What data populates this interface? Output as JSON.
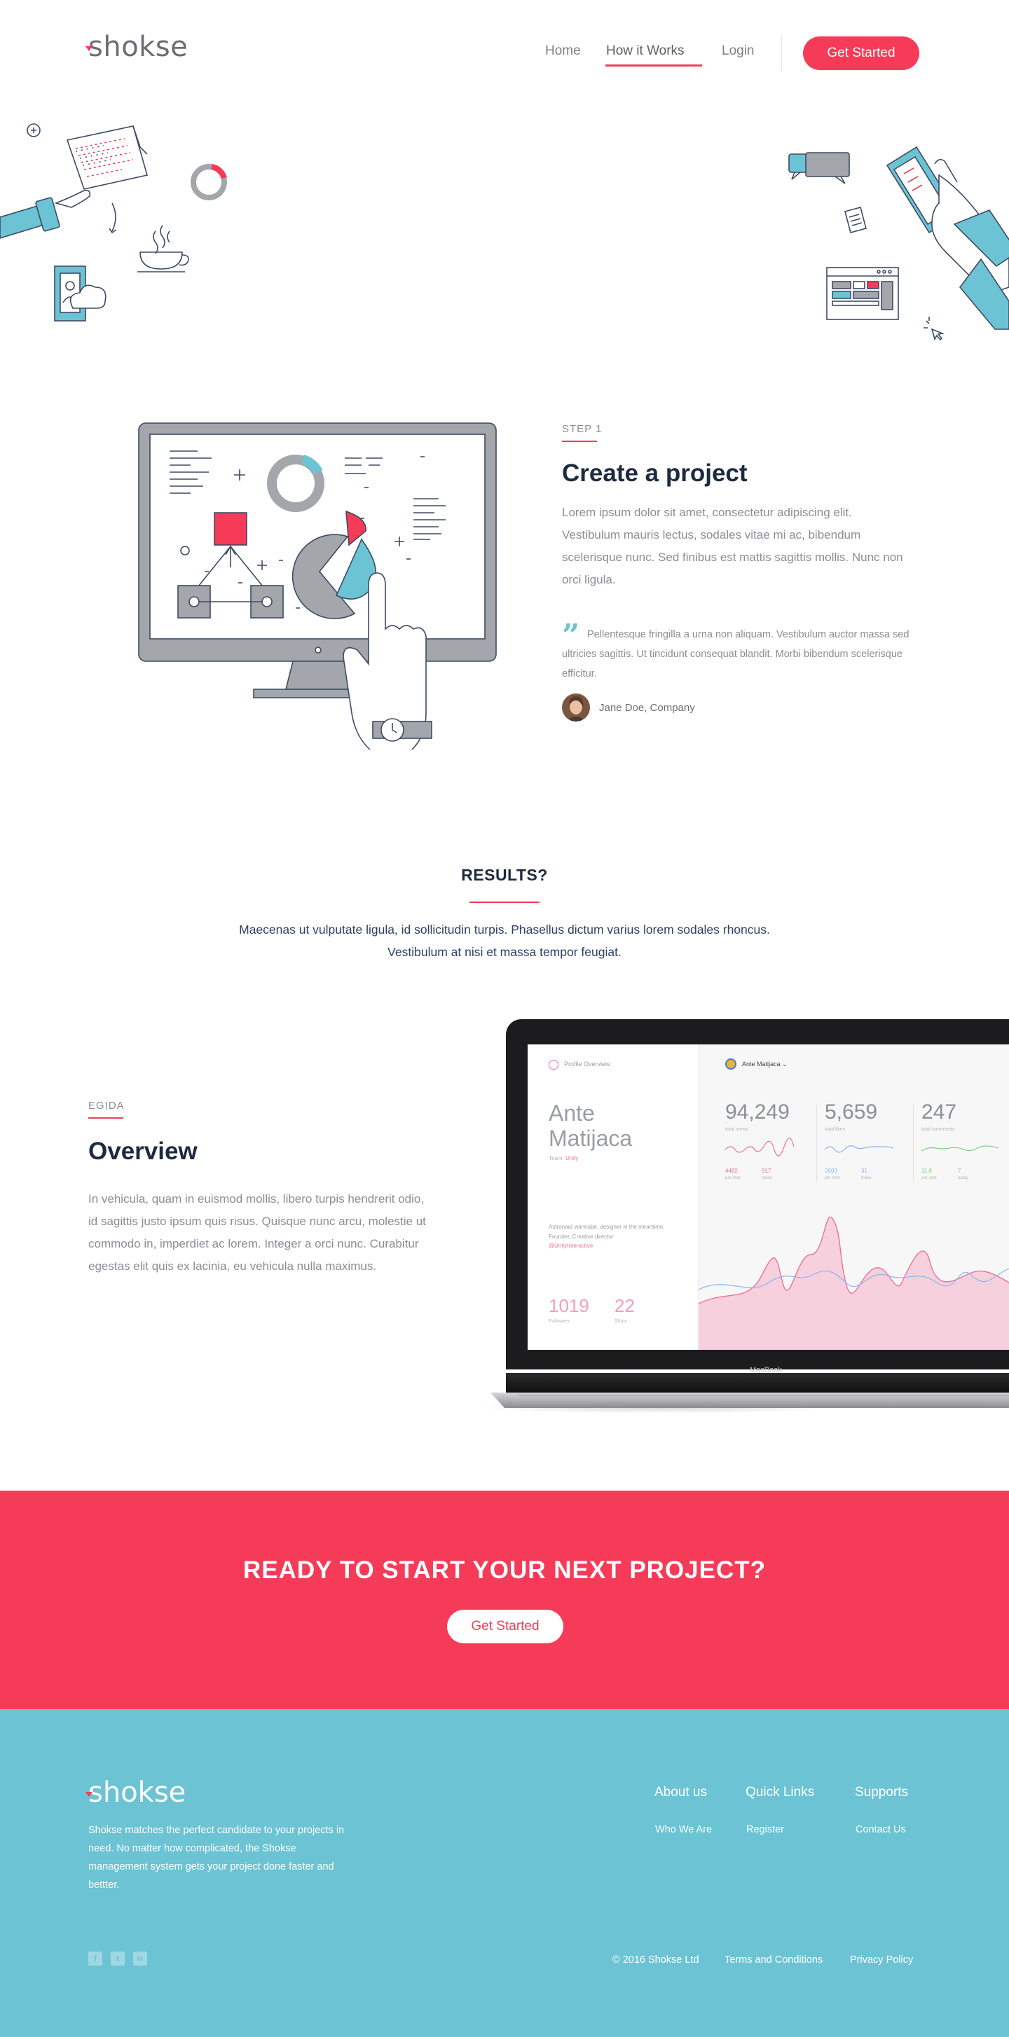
{
  "brand": {
    "name": "shokse",
    "accent": "#f53b57",
    "teal": "#6cc3d4",
    "dark": "#1d2a3f"
  },
  "nav": {
    "items": [
      {
        "label": "Home",
        "active": false
      },
      {
        "label": "How it Works",
        "active": true
      },
      {
        "label": "Login",
        "active": false
      }
    ],
    "cta": "Get Started"
  },
  "step": {
    "label": "STEP 1",
    "title": "Create a project",
    "body": "Lorem ipsum dolor sit amet, consectetur adipiscing elit. Vestibulum mauris lectus, sodales vitae mi ac, bibendum scelerisque nunc. Sed finibus est mattis sagittis mollis. Nunc non orci ligula.",
    "quote": "Pellentesque fringilla a urna non aliquam. Vestibulum auctor massa sed ultricies sagittis.  Ut tincidunt consequat blandit. Morbi bibendum scelerisque efficitur.",
    "author": "Jane Doe, Company"
  },
  "results": {
    "title": "RESULTS?",
    "body": "Maecenas ut vulputate ligula, id sollicitudin turpis. Phasellus dictum varius lorem sodales rhoncus. Vestibulum at nisi et massa tempor feugiat."
  },
  "overview": {
    "label": "EGIDA",
    "title": "Overview",
    "body": "In vehicula, quam in euismod mollis, libero turpis hendrerit odio, id sagittis justo ipsum quis risus. Quisque nunc arcu, molestie ut commodo in, imperdiet ac lorem. Integer a orci nunc. Curabitur egestas elit quis ex lacinia, eu vehicula nulla maximus."
  },
  "dashboard": {
    "header": "Profile Overview",
    "user": "Ante Matijaca",
    "name_line1": "Ante",
    "name_line2": "Matijaca",
    "team_label": "Team:",
    "team": "Unity",
    "bio": "Astronaut wannabe, designer in the meantime. Founder, Creative director",
    "handle": "@UnityInteractive",
    "followers": "1019",
    "followers_label": "Followers",
    "shots": "22",
    "shots_label": "Shots",
    "stats": [
      {
        "value": "94,249",
        "label": "total views",
        "a": "4482",
        "a_label": "per shot",
        "b": "917",
        "b_label": "today",
        "color": "#f0709a"
      },
      {
        "value": "5,659",
        "label": "total likes",
        "a": "2693",
        "a_label": "per shot",
        "b": "31",
        "b_label": "today",
        "color": "#8ab4f0"
      },
      {
        "value": "247",
        "label": "total comments",
        "a": "11.8",
        "a_label": "per shot",
        "b": "7",
        "b_label": "today",
        "color": "#7bd07b"
      }
    ],
    "device_label": "MacBook"
  },
  "cta": {
    "title": "READY TO START YOUR NEXT PROJECT?",
    "button": "Get Started"
  },
  "footer": {
    "logo": "shokse",
    "description": "Shokse matches the perfect candidate to your projects in need. No matter how complicated, the Shokse management system gets your project done faster and bettter.",
    "columns": [
      {
        "title": "About us",
        "link": "Who We Are"
      },
      {
        "title": "Quick Links",
        "link": "Register"
      },
      {
        "title": "Supports",
        "link": "Contact Us"
      }
    ],
    "social": [
      "f",
      "t",
      "in"
    ],
    "copyright": "© 2016 Shokse Ltd",
    "terms": "Terms and Conditions",
    "privacy": "Privacy Policy"
  }
}
